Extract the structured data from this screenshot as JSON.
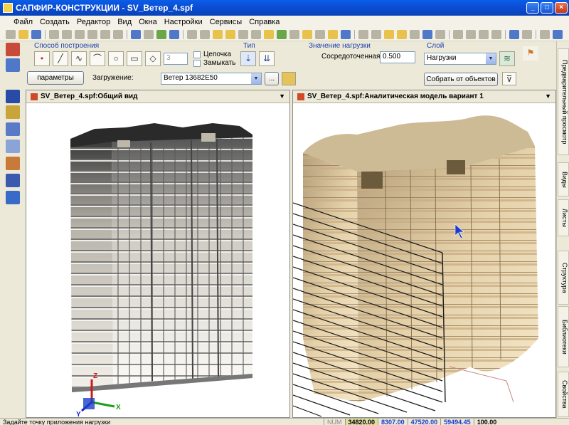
{
  "window": {
    "title": "САПФИР-КОНСТРУКЦИИ - SV_Ветер_4.spf",
    "min": "_",
    "max": "□",
    "close": "×"
  },
  "menu": [
    "Файл",
    "Создать",
    "Редактор",
    "Вид",
    "Окна",
    "Настройки",
    "Сервисы",
    "Справка"
  ],
  "props": {
    "build_group": "Способ построения",
    "type_group": "Тип",
    "load_value_group": "Значение нагрузки",
    "layer_group": "Слой",
    "count_value": "3",
    "chain_label": "Цепочка",
    "close_label": "Замыкать",
    "params_button": "параметры",
    "loading_label": "Загружение:",
    "loading_value": "Ветер 13682Е50",
    "ellipsis": "...",
    "concentrated_label": "Сосредоточенная:",
    "concentrated_value": "0.500",
    "layer_value": "Нагрузки",
    "collect_button": "Собрать от объектов"
  },
  "right_dock": [
    "Предварительный просмотр",
    "Виды",
    "Листы",
    "Структура",
    "Библиотеки",
    "Свойства"
  ],
  "views": {
    "left_title": "SV_Ветер_4.spf:Общий вид",
    "right_title": "SV_Ветер_4.spf:Аналитическая модель вариант 1",
    "axis_z": "Z",
    "axis_x": "X",
    "axis_y": "Y"
  },
  "status": {
    "message": "Задайте точку приложения нагрузки",
    "mode": "NUM",
    "values": [
      "34820.00",
      "8307.00",
      "47520.00",
      "59494.45",
      "100.00"
    ]
  },
  "colors": {
    "titlebar": "#0b4fd6",
    "panel": "#ece9d8",
    "building_left": "#e8e2d4",
    "building_right": "#e4cfa6",
    "wind_lines": "#1a1a1a"
  }
}
